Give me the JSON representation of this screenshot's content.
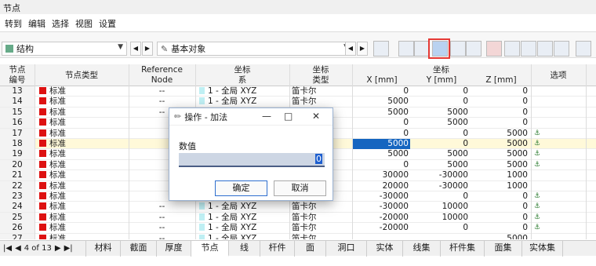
{
  "window": {
    "title": "节点"
  },
  "menu": [
    "转到",
    "编辑",
    "选择",
    "视图",
    "设置"
  ],
  "toolbar": {
    "structure_label": "结构",
    "basic_objects_label": "基本对象"
  },
  "columns": {
    "c1": "节点\n编号",
    "c2": "节点类型",
    "c3": "Reference\nNode",
    "c4": "坐标\n系",
    "c5": "坐标\n类型",
    "c6": "坐标",
    "x": "X [mm]",
    "y": "Y [mm]",
    "z": "Z [mm]",
    "opt": "选项"
  },
  "rows": [
    {
      "no": "13",
      "type": "标准",
      "ref": "--",
      "cs": "1 - 全局 XYZ",
      "ctype": "笛卡尔",
      "x": "0",
      "y": "0",
      "z": "0",
      "pin": false
    },
    {
      "no": "14",
      "type": "标准",
      "ref": "--",
      "cs": "1 - 全局 XYZ",
      "ctype": "笛卡尔",
      "x": "5000",
      "y": "0",
      "z": "0",
      "pin": false
    },
    {
      "no": "15",
      "type": "标准",
      "ref": "--",
      "cs": "",
      "ctype": "",
      "x": "5000",
      "y": "5000",
      "z": "0",
      "pin": false
    },
    {
      "no": "16",
      "type": "标准",
      "ref": "",
      "cs": "",
      "ctype": "",
      "x": "0",
      "y": "5000",
      "z": "0",
      "pin": false
    },
    {
      "no": "17",
      "type": "标准",
      "ref": "",
      "cs": "",
      "ctype": "",
      "x": "0",
      "y": "0",
      "z": "5000",
      "pin": true
    },
    {
      "no": "18",
      "type": "标准",
      "ref": "",
      "cs": "",
      "ctype": "",
      "x": "5000",
      "y": "0",
      "z": "5000",
      "pin": true
    },
    {
      "no": "19",
      "type": "标准",
      "ref": "",
      "cs": "",
      "ctype": "",
      "x": "5000",
      "y": "5000",
      "z": "5000",
      "pin": true
    },
    {
      "no": "20",
      "type": "标准",
      "ref": "",
      "cs": "",
      "ctype": "",
      "x": "0",
      "y": "5000",
      "z": "5000",
      "pin": true
    },
    {
      "no": "21",
      "type": "标准",
      "ref": "",
      "cs": "",
      "ctype": "",
      "x": "30000",
      "y": "-30000",
      "z": "1000",
      "pin": false
    },
    {
      "no": "22",
      "type": "标准",
      "ref": "",
      "cs": "",
      "ctype": "",
      "x": "20000",
      "y": "-30000",
      "z": "1000",
      "pin": false
    },
    {
      "no": "23",
      "type": "标准",
      "ref": "",
      "cs": "",
      "ctype": "",
      "x": "-30000",
      "y": "0",
      "z": "0",
      "pin": true
    },
    {
      "no": "24",
      "type": "标准",
      "ref": "--",
      "cs": "1 - 全局 XYZ",
      "ctype": "笛卡尔",
      "x": "-30000",
      "y": "10000",
      "z": "0",
      "pin": true
    },
    {
      "no": "25",
      "type": "标准",
      "ref": "--",
      "cs": "1 - 全局 XYZ",
      "ctype": "笛卡尔",
      "x": "-20000",
      "y": "10000",
      "z": "0",
      "pin": true
    },
    {
      "no": "26",
      "type": "标准",
      "ref": "--",
      "cs": "1 - 全局 XYZ",
      "ctype": "笛卡尔",
      "x": "-20000",
      "y": "0",
      "z": "0",
      "pin": true
    },
    {
      "no": "27",
      "type": "标准",
      "ref": "--",
      "cs": "1 - 全局 XYZ",
      "ctype": "笛卡尔",
      "x": "",
      "y": "",
      "z": "5000",
      "pin": false
    }
  ],
  "dialog": {
    "title": "操作 - 加法",
    "field_label": "数值",
    "field_value": "0",
    "ok": "确定",
    "cancel": "取消"
  },
  "pager": {
    "text": "4 of 13"
  },
  "tabs": [
    "材料",
    "截面",
    "厚度",
    "节点",
    "线",
    "杆件",
    "面",
    "洞口",
    "实体",
    "线集",
    "杆件集",
    "面集",
    "实体集"
  ],
  "active_tab": "节点",
  "colors": {
    "node_swatch": "#dd1111",
    "selection_blue": "#1565c0",
    "highlight_red": "#e53935"
  }
}
